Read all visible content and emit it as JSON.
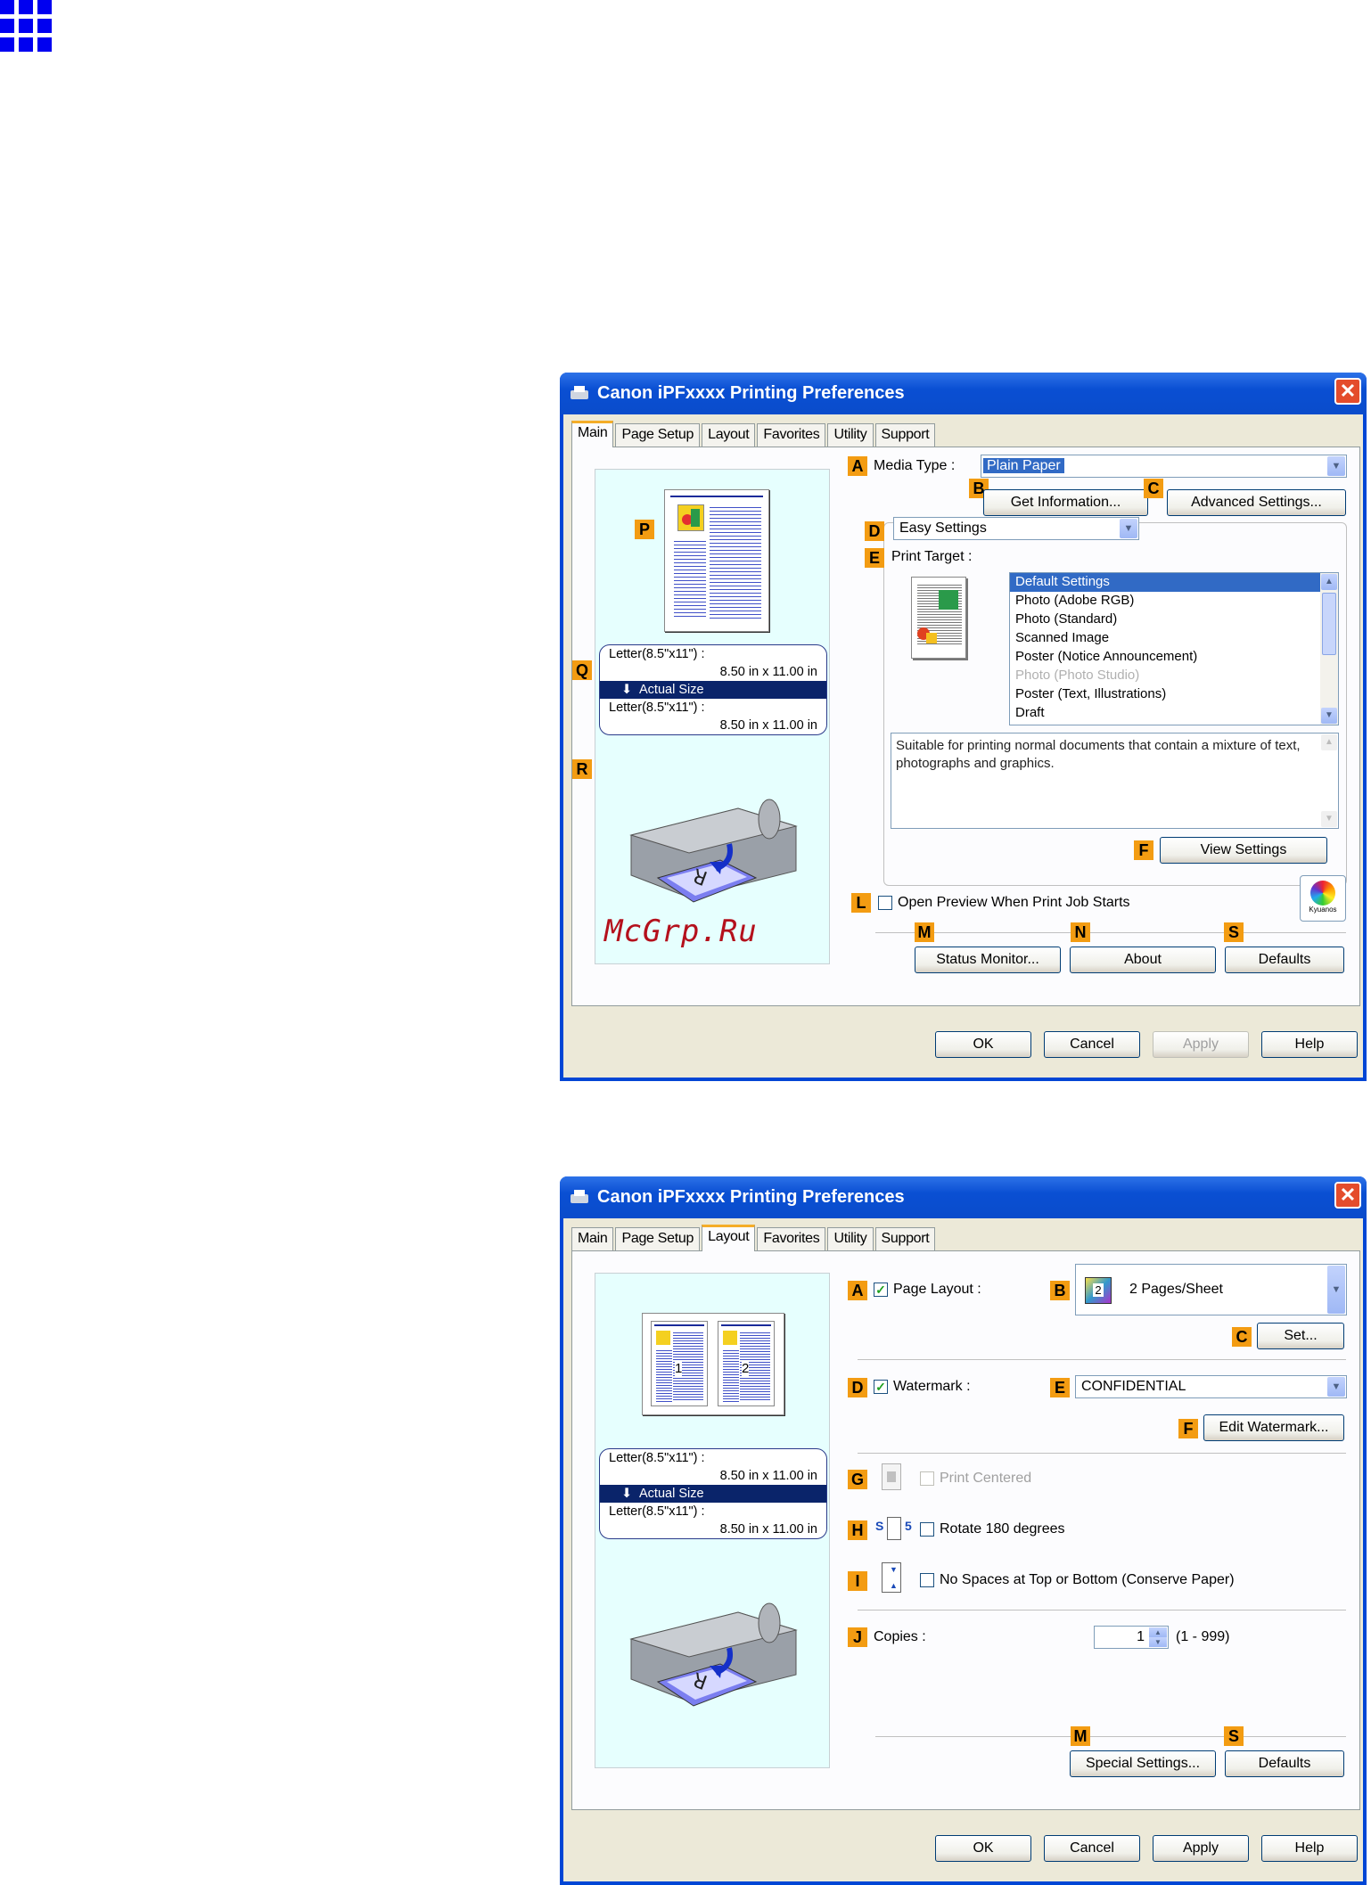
{
  "corner_icon": "grid-icon",
  "dialog1": {
    "title": "Canon iPFxxxx Printing Preferences",
    "tabs": [
      "Main",
      "Page Setup",
      "Layout",
      "Favorites",
      "Utility",
      "Support"
    ],
    "active_tab": "Main",
    "badges": {
      "A": "A",
      "B": "B",
      "C": "C",
      "D": "D",
      "E": "E",
      "F": "F",
      "L": "L",
      "M": "M",
      "N": "N",
      "S": "S",
      "P": "P",
      "Q": "Q",
      "R": "R"
    },
    "media_type_label": "Media Type :",
    "media_type_value": "Plain Paper",
    "get_info_button": "Get Information...",
    "advanced_button": "Advanced Settings...",
    "easy_settings_value": "Easy Settings",
    "print_target_label": "Print Target :",
    "print_targets": [
      "Default Settings",
      "Photo (Adobe RGB)",
      "Photo (Standard)",
      "Scanned Image",
      "Poster (Notice Announcement)",
      "Photo (Photo Studio)",
      "Poster (Text, Illustrations)",
      "Draft"
    ],
    "description": "Suitable for printing normal documents that contain a mixture of text, photographs and graphics.",
    "view_settings_button": "View Settings",
    "open_preview_label": "Open Preview When Print Job Starts",
    "kyuanos_label": "Kyuanos",
    "status_monitor_button": "Status Monitor...",
    "about_button": "About",
    "defaults_button": "Defaults",
    "paper_in_label": "Letter(8.5\"x11\") :",
    "paper_in_size": "8.50 in x 11.00 in",
    "actual_size_label": "Actual Size",
    "paper_out_label": "Letter(8.5\"x11\") :",
    "paper_out_size": "8.50 in x 11.00 in",
    "watermark_text": "McGrp.Ru",
    "ok_button": "OK",
    "cancel_button": "Cancel",
    "apply_button": "Apply",
    "help_button": "Help"
  },
  "dialog2": {
    "title": "Canon iPFxxxx Printing Preferences",
    "tabs": [
      "Main",
      "Page Setup",
      "Layout",
      "Favorites",
      "Utility",
      "Support"
    ],
    "active_tab": "Layout",
    "page_layout_label": "Page Layout :",
    "page_layout_value": "2 Pages/Sheet",
    "set_button": "Set...",
    "watermark_label": "Watermark :",
    "watermark_value": "CONFIDENTIAL",
    "edit_watermark_button": "Edit Watermark...",
    "print_centered_label": "Print Centered",
    "rotate_label": "Rotate 180 degrees",
    "no_spaces_label": "No Spaces at Top or Bottom (Conserve Paper)",
    "copies_label": "Copies :",
    "copies_value": "1",
    "copies_range": "(1 - 999)",
    "page_num_1": "1",
    "page_num_2": "2",
    "layout_icon_num": "2",
    "special_settings_button": "Special Settings...",
    "defaults_button": "Defaults",
    "paper_in_label": "Letter(8.5\"x11\") :",
    "paper_in_size": "8.50 in x 11.00 in",
    "actual_size_label": "Actual Size",
    "paper_out_label": "Letter(8.5\"x11\") :",
    "paper_out_size": "8.50 in x 11.00 in",
    "ok_button": "OK",
    "cancel_button": "Cancel",
    "apply_button": "Apply",
    "help_button": "Help"
  }
}
